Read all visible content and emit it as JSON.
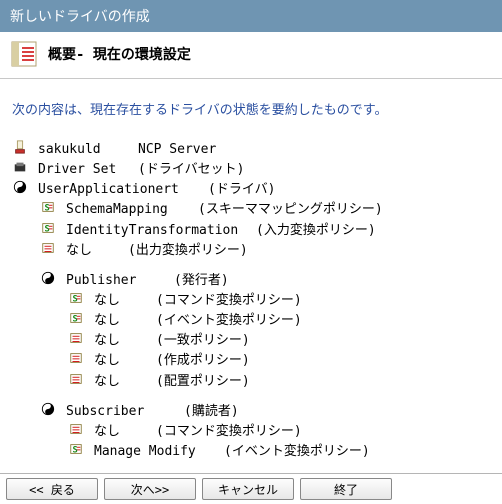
{
  "title": "新しいドライバの作成",
  "header": "概要- 現在の環境設定",
  "intro": "次の内容は、現在存在するドライバの状態を要約したものです。",
  "tree": {
    "server": {
      "name": "sakukuld",
      "desc": "NCP Server"
    },
    "driverset": {
      "name": "Driver Set",
      "desc": "(ドライバセット)"
    },
    "driver": {
      "name": "UserApplicationert",
      "desc": "(ドライバ)"
    },
    "driver_children": [
      {
        "name": "SchemaMapping",
        "desc": "(スキーママッピングポリシー)"
      },
      {
        "name": "IdentityTransformation",
        "desc": "(入力変換ポリシー)"
      },
      {
        "name": "なし",
        "desc": "(出力変換ポリシー)"
      }
    ],
    "publisher": {
      "name": "Publisher",
      "desc": "(発行者)"
    },
    "publisher_children": [
      {
        "name": "なし",
        "desc": "(コマンド変換ポリシー)"
      },
      {
        "name": "なし",
        "desc": "(イベント変換ポリシー)"
      },
      {
        "name": "なし",
        "desc": "(一致ポリシー)"
      },
      {
        "name": "なし",
        "desc": "(作成ポリシー)"
      },
      {
        "name": "なし",
        "desc": "(配置ポリシー)"
      }
    ],
    "subscriber": {
      "name": "Subscriber",
      "desc": "(購読者)"
    },
    "subscriber_children": [
      {
        "name": "なし",
        "desc": "(コマンド変換ポリシー)"
      },
      {
        "name": "Manage Modify",
        "desc": "(イベント変換ポリシー)"
      }
    ]
  },
  "buttons": {
    "back": "<< 戻る",
    "next": "次へ>>",
    "cancel": "キャンセル",
    "finish": "終了"
  },
  "icons": {
    "header": "script-icon",
    "server": "server-icon",
    "driverset": "driverset-icon",
    "driver": "yinyang-icon",
    "policy": "policy-icon",
    "channel": "yinyang-icon"
  }
}
